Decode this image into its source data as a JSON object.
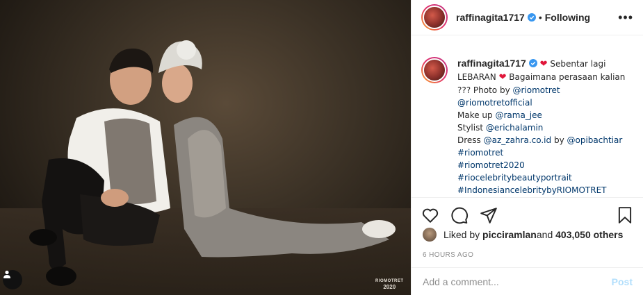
{
  "post": {
    "username": "raffinagita1717",
    "following_label": "Following",
    "more_label": "•••",
    "photo_watermark_line1": "RIOMOTRET",
    "photo_watermark_line2": "2020"
  },
  "caption": {
    "username": "raffinagita1717",
    "text_1": " Sebentar lagi LEBARAN ",
    "text_2": " Bagaimana perasaan kalian ??? Photo by ",
    "mention_1": "@riomotret",
    "mention_2": "@riomotretofficial",
    "line_makeup": "Make up ",
    "mention_3": "@rama_jee",
    "line_stylist": "Stylist ",
    "mention_4": "@erichalamin",
    "line_dress": "Dress ",
    "mention_5": "@az_zahra.co.id",
    "line_by": " by ",
    "mention_6": "@opibachtiar",
    "hashtag_1": "#riomotret",
    "hashtag_2": "#riomotret2020",
    "hashtag_3": "#riocelebritybeautyportrait",
    "hashtag_4": "#IndonesiancelebritybyRIOMOTRET"
  },
  "likes": {
    "prefix": "Liked by ",
    "user": "picciramlan",
    "middle": " and ",
    "count": "403,050 others"
  },
  "timestamp": "6 HOURS AGO",
  "comment_box": {
    "placeholder": "Add a comment...",
    "post_label": "Post"
  },
  "colors": {
    "verified": "#3897f0",
    "link": "#00376b",
    "post_disabled": "#b2dffc",
    "heart": "#e0163a"
  }
}
